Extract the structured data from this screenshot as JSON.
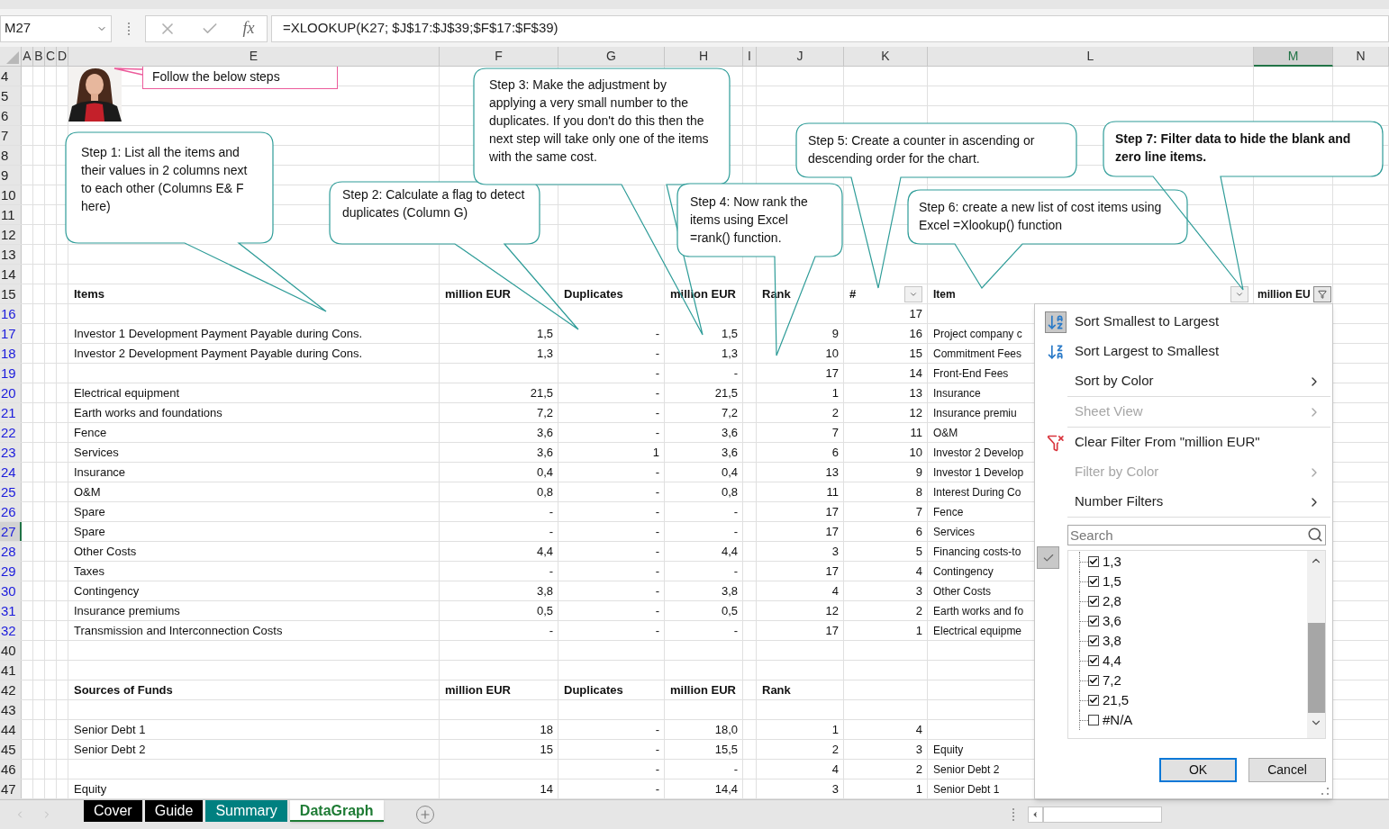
{
  "formula_bar": {
    "name_box": "M27",
    "fx": "fx",
    "formula": "=XLOOKUP(K27; $J$17:$J$39;$F$17:$F$39)"
  },
  "columns": [
    {
      "label": "A",
      "selected": false
    },
    {
      "label": "B",
      "selected": false
    },
    {
      "label": "C",
      "selected": false
    },
    {
      "label": "D",
      "selected": false
    },
    {
      "label": "E",
      "selected": false
    },
    {
      "label": "F",
      "selected": false
    },
    {
      "label": "G",
      "selected": false
    },
    {
      "label": "H",
      "selected": false
    },
    {
      "label": "I",
      "selected": false
    },
    {
      "label": "J",
      "selected": false
    },
    {
      "label": "K",
      "selected": false,
      "filter_applied": false
    },
    {
      "label": "L",
      "selected": false,
      "filter_applied": false
    },
    {
      "label": "M",
      "selected": true,
      "filter_applied": true
    },
    {
      "label": "N",
      "selected": false
    }
  ],
  "rows": [
    {
      "number": "4",
      "filtered": false,
      "selected": false,
      "kind": "data",
      "cells": [
        null,
        null,
        null,
        null,
        null,
        null,
        null,
        null
      ]
    },
    {
      "number": "5",
      "filtered": false,
      "selected": false,
      "kind": "data",
      "cells": [
        null,
        null,
        null,
        null,
        null,
        null,
        null,
        null
      ]
    },
    {
      "number": "6",
      "filtered": false,
      "selected": false,
      "kind": "data",
      "cells": [
        null,
        null,
        null,
        null,
        null,
        null,
        null,
        null
      ]
    },
    {
      "number": "7",
      "filtered": false,
      "selected": false,
      "kind": "data",
      "cells": [
        null,
        null,
        null,
        null,
        null,
        null,
        null,
        null
      ]
    },
    {
      "number": "8",
      "filtered": false,
      "selected": false,
      "kind": "data",
      "cells": [
        null,
        null,
        null,
        null,
        null,
        null,
        null,
        null
      ]
    },
    {
      "number": "9",
      "filtered": false,
      "selected": false,
      "kind": "data",
      "cells": [
        null,
        null,
        null,
        null,
        null,
        null,
        null,
        null
      ]
    },
    {
      "number": "10",
      "filtered": false,
      "selected": false,
      "kind": "data",
      "cells": [
        null,
        null,
        null,
        null,
        null,
        null,
        null,
        null
      ]
    },
    {
      "number": "11",
      "filtered": false,
      "selected": false,
      "kind": "data",
      "cells": [
        null,
        null,
        null,
        null,
        null,
        null,
        null,
        null
      ]
    },
    {
      "number": "12",
      "filtered": false,
      "selected": false,
      "kind": "data",
      "cells": [
        null,
        null,
        null,
        null,
        null,
        null,
        null,
        null
      ]
    },
    {
      "number": "13",
      "filtered": false,
      "selected": false,
      "kind": "data",
      "cells": [
        null,
        null,
        null,
        null,
        null,
        null,
        null,
        null
      ]
    },
    {
      "number": "14",
      "filtered": false,
      "selected": false,
      "kind": "data",
      "cells": [
        null,
        null,
        null,
        null,
        null,
        null,
        null,
        null
      ]
    },
    {
      "number": "15",
      "filtered": false,
      "selected": false,
      "kind": "table_header",
      "cells": [
        "Items",
        "million EUR",
        "Duplicates",
        "million EUR",
        "Rank",
        "#",
        "Item",
        "million EU"
      ]
    },
    {
      "number": "16",
      "filtered": true,
      "selected": false,
      "kind": "data",
      "cells": [
        null,
        null,
        null,
        null,
        null,
        "17",
        null,
        null
      ]
    },
    {
      "number": "17",
      "filtered": true,
      "selected": false,
      "kind": "data",
      "cells": [
        "Investor 1 Development Payment Payable during Cons.",
        "1,5",
        "-",
        "1,5",
        "9",
        "16",
        "Project company c",
        null
      ]
    },
    {
      "number": "18",
      "filtered": true,
      "selected": false,
      "kind": "data",
      "cells": [
        "Investor 2 Development Payment Payable during Cons.",
        "1,3",
        "-",
        "1,3",
        "10",
        "15",
        "Commitment Fees",
        null
      ]
    },
    {
      "number": "19",
      "filtered": true,
      "selected": false,
      "kind": "data",
      "cells": [
        null,
        null,
        "-",
        "-",
        "17",
        "14",
        "Front-End Fees",
        null
      ]
    },
    {
      "number": "20",
      "filtered": true,
      "selected": false,
      "kind": "data",
      "cells": [
        "Electrical equipment",
        "21,5",
        "-",
        "21,5",
        "1",
        "13",
        "Insurance",
        null
      ]
    },
    {
      "number": "21",
      "filtered": true,
      "selected": false,
      "kind": "data",
      "cells": [
        "Earth works and foundations",
        "7,2",
        "-",
        "7,2",
        "2",
        "12",
        "Insurance premiu",
        null
      ]
    },
    {
      "number": "22",
      "filtered": true,
      "selected": false,
      "kind": "data",
      "cells": [
        "Fence",
        "3,6",
        "-",
        "3,6",
        "7",
        "11",
        "O&M",
        null
      ]
    },
    {
      "number": "23",
      "filtered": true,
      "selected": false,
      "kind": "data",
      "cells": [
        "Services",
        "3,6",
        "1",
        "3,6",
        "6",
        "10",
        "Investor 2 Develop",
        null
      ]
    },
    {
      "number": "24",
      "filtered": true,
      "selected": false,
      "kind": "data",
      "cells": [
        "Insurance",
        "0,4",
        "-",
        "0,4",
        "13",
        "9",
        "Investor 1 Develop",
        null
      ]
    },
    {
      "number": "25",
      "filtered": true,
      "selected": false,
      "kind": "data",
      "cells": [
        "O&M",
        "0,8",
        "-",
        "0,8",
        "11",
        "8",
        "Interest During Co",
        null
      ]
    },
    {
      "number": "26",
      "filtered": true,
      "selected": false,
      "kind": "data",
      "cells": [
        "Spare",
        "-",
        "-",
        "-",
        "17",
        "7",
        "Fence",
        null
      ]
    },
    {
      "number": "27",
      "filtered": true,
      "selected": true,
      "kind": "data",
      "cells": [
        "Spare",
        "-",
        "-",
        "-",
        "17",
        "6",
        "Services",
        null
      ]
    },
    {
      "number": "28",
      "filtered": true,
      "selected": false,
      "kind": "data",
      "cells": [
        "Other Costs",
        "4,4",
        "-",
        "4,4",
        "3",
        "5",
        "Financing costs-to",
        null
      ]
    },
    {
      "number": "29",
      "filtered": true,
      "selected": false,
      "kind": "data",
      "cells": [
        "Taxes",
        "-",
        "-",
        "-",
        "17",
        "4",
        "Contingency",
        null
      ]
    },
    {
      "number": "30",
      "filtered": true,
      "selected": false,
      "kind": "data",
      "cells": [
        "Contingency",
        "3,8",
        "-",
        "3,8",
        "4",
        "3",
        "Other Costs",
        null
      ]
    },
    {
      "number": "31",
      "filtered": true,
      "selected": false,
      "kind": "data",
      "cells": [
        "Insurance premiums",
        "0,5",
        "-",
        "0,5",
        "12",
        "2",
        "Earth works and fo",
        null
      ]
    },
    {
      "number": "32",
      "filtered": true,
      "selected": false,
      "kind": "data",
      "cells": [
        "Transmission and Interconnection Costs",
        "-",
        "-",
        "-",
        "17",
        "1",
        "Electrical equipme",
        null
      ]
    },
    {
      "number": "40",
      "filtered": false,
      "selected": false,
      "kind": "data",
      "cells": [
        null,
        null,
        null,
        null,
        null,
        null,
        null,
        null
      ]
    },
    {
      "number": "41",
      "filtered": false,
      "selected": false,
      "kind": "data",
      "cells": [
        null,
        null,
        null,
        null,
        null,
        null,
        null,
        null
      ]
    },
    {
      "number": "42",
      "filtered": false,
      "selected": false,
      "kind": "section_header",
      "cells": [
        "Sources of Funds",
        "million EUR",
        "Duplicates",
        "million EUR",
        "Rank",
        null,
        null,
        null
      ]
    },
    {
      "number": "43",
      "filtered": false,
      "selected": false,
      "kind": "data",
      "cells": [
        null,
        null,
        null,
        null,
        null,
        null,
        null,
        null
      ]
    },
    {
      "number": "44",
      "filtered": false,
      "selected": false,
      "kind": "data",
      "cells": [
        "Senior Debt 1",
        "18",
        "-",
        "18,0",
        "1",
        "4",
        null,
        null
      ]
    },
    {
      "number": "45",
      "filtered": false,
      "selected": false,
      "kind": "data",
      "cells": [
        "Senior Debt 2",
        "15",
        "-",
        "15,5",
        "2",
        "3",
        "Equity",
        null
      ]
    },
    {
      "number": "46",
      "filtered": false,
      "selected": false,
      "kind": "data",
      "cells": [
        null,
        null,
        "-",
        "-",
        "4",
        "2",
        "Senior Debt 2",
        null
      ]
    },
    {
      "number": "47",
      "filtered": false,
      "selected": false,
      "kind": "data",
      "cells": [
        "Equity",
        "14",
        "-",
        "14,4",
        "3",
        "1",
        "Senior Debt 1",
        null
      ]
    }
  ],
  "callouts": [
    {
      "kind": "note",
      "text": "Follow the below steps",
      "bold": false
    },
    {
      "kind": "speech",
      "text": "Step 1: List all the items and their values in 2 columns next to each other (Columns E& F here)",
      "bold": false
    },
    {
      "kind": "speech",
      "text": "Step 2: Calculate a flag to detect duplicates (Column G)",
      "bold": false
    },
    {
      "kind": "speech",
      "text": "Step 3: Make the adjustment by applying a very small number to the duplicates. If you don't do this then the next step will take only one of the items with the same cost.",
      "bold": false
    },
    {
      "kind": "speech",
      "text": "Step 4: Now rank the items using Excel =rank() function.",
      "bold": false
    },
    {
      "kind": "speech",
      "text": "Step 5: Create a counter in ascending or descending order for the chart.",
      "bold": false
    },
    {
      "kind": "speech",
      "text": "Step 6: create a new list of cost items using Excel =Xlookup() function",
      "bold": false
    },
    {
      "kind": "speech",
      "text": "Step 7: Filter data to hide the blank and zero line items.",
      "bold": true
    }
  ],
  "filter_menu": {
    "items": [
      {
        "label": "Sort Smallest to Largest",
        "kind": "sort_ascending",
        "disabled": false,
        "divider_after": false
      },
      {
        "label": "Sort Largest to Smallest",
        "kind": "sort_descending",
        "disabled": false,
        "divider_after": false
      },
      {
        "label": "Sort by Color",
        "kind": "submenu",
        "disabled": false,
        "divider_after": true
      },
      {
        "label": "Sheet View",
        "kind": "submenu",
        "disabled": true,
        "divider_after": true
      },
      {
        "label": "Clear Filter From \"million EUR\"",
        "kind": "clear_filter",
        "disabled": false,
        "divider_after": false
      },
      {
        "label": "Filter by Color",
        "kind": "submenu",
        "disabled": true,
        "divider_after": false
      },
      {
        "label": "Number Filters",
        "kind": "submenu",
        "disabled": false,
        "divider_after": true
      }
    ],
    "search": {
      "placeholder": "Search"
    },
    "values": [
      {
        "label": "1,3",
        "checked": true
      },
      {
        "label": "1,5",
        "checked": true
      },
      {
        "label": "2,8",
        "checked": true
      },
      {
        "label": "3,6",
        "checked": true
      },
      {
        "label": "3,8",
        "checked": true
      },
      {
        "label": "4,4",
        "checked": true
      },
      {
        "label": "7,2",
        "checked": true
      },
      {
        "label": "21,5",
        "checked": true
      },
      {
        "label": "#N/A",
        "checked": false
      }
    ],
    "buttons": [
      {
        "label": "OK",
        "default": true
      },
      {
        "label": "Cancel",
        "default": false
      }
    ]
  },
  "sheet_tabs": [
    {
      "label": "Cover",
      "color": "#000000",
      "selected": false
    },
    {
      "label": "Guide",
      "color": "#000000",
      "selected": false
    },
    {
      "label": "Summary",
      "color": "#008080",
      "selected": false
    },
    {
      "label": "DataGraph",
      "color": "#1e7b34",
      "selected": true
    }
  ]
}
